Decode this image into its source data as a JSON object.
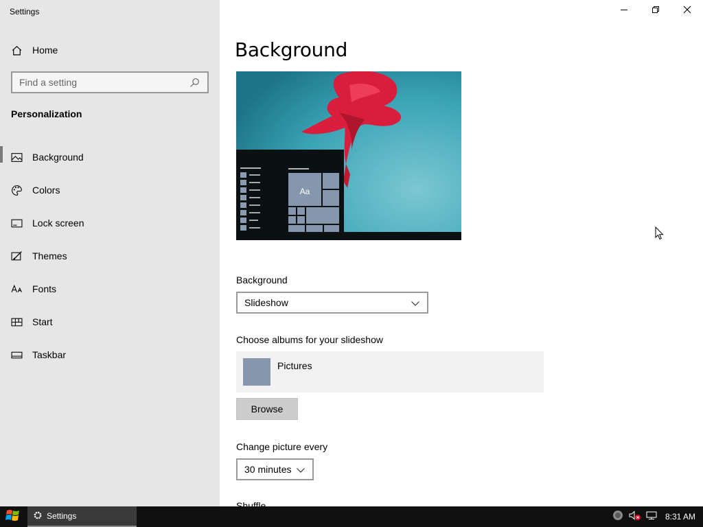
{
  "window": {
    "title": "Settings"
  },
  "sidebar": {
    "home_label": "Home",
    "search_placeholder": "Find a setting",
    "section_title": "Personalization",
    "items": [
      {
        "label": "Background",
        "icon": "image-icon",
        "active": true
      },
      {
        "label": "Colors",
        "icon": "palette-icon"
      },
      {
        "label": "Lock screen",
        "icon": "lock-screen-icon"
      },
      {
        "label": "Themes",
        "icon": "themes-icon"
      },
      {
        "label": "Fonts",
        "icon": "fonts-icon"
      },
      {
        "label": "Start",
        "icon": "start-icon"
      },
      {
        "label": "Taskbar",
        "icon": "taskbar-icon"
      }
    ]
  },
  "main": {
    "title": "Background",
    "preview": {
      "tile_text": "Aa"
    },
    "background_label": "Background",
    "background_value": "Slideshow",
    "albums_label": "Choose albums for your slideshow",
    "album_name": "Pictures",
    "browse_label": "Browse",
    "change_label": "Change picture every",
    "change_value": "30 minutes",
    "shuffle_label": "Shuffle"
  },
  "taskbar": {
    "app_label": "Settings",
    "clock": "8:31 AM"
  },
  "colors": {
    "sidebar_bg": "#e6e6e6",
    "taskbar_bg": "#101010",
    "accent_tile": "#8696ad"
  }
}
